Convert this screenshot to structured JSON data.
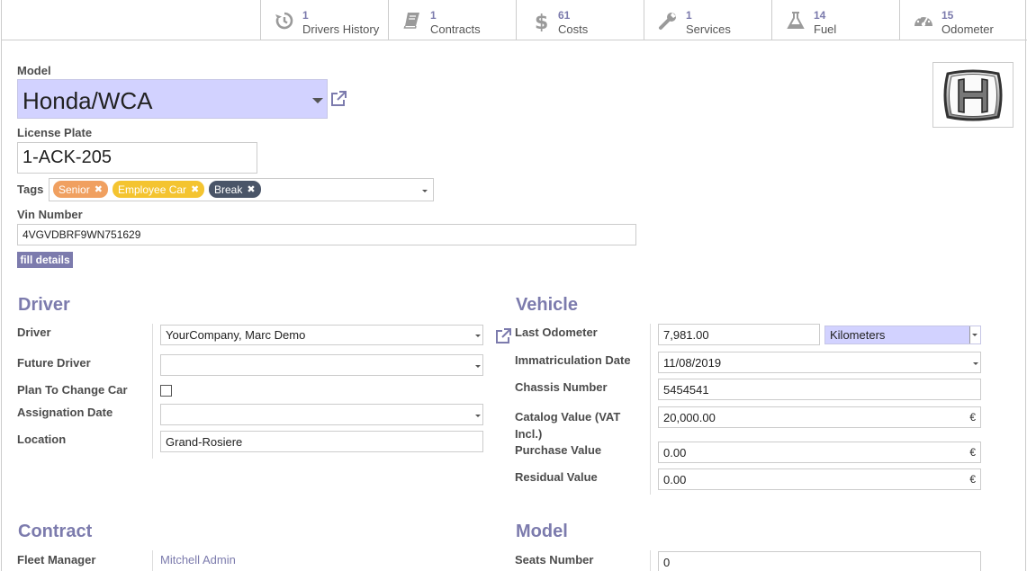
{
  "smart_buttons": [
    {
      "value": "1",
      "label": "Drivers History",
      "icon": "history-icon"
    },
    {
      "value": "1",
      "label": "Contracts",
      "icon": "book-icon"
    },
    {
      "value": "61",
      "label": "Costs",
      "icon": "dollar-icon"
    },
    {
      "value": "1",
      "label": "Services",
      "icon": "wrench-icon"
    },
    {
      "value": "14",
      "label": "Fuel",
      "icon": "flask-icon"
    },
    {
      "value": "15",
      "label": "Odometer",
      "icon": "tachometer-icon"
    }
  ],
  "header": {
    "model_label": "Model",
    "model_value": "Honda/WCA",
    "plate_label": "License Plate",
    "plate_value": "1-ACK-205",
    "tags_label": "Tags",
    "tags": [
      {
        "name": "Senior",
        "color": "#f0a060"
      },
      {
        "name": "Employee Car",
        "color": "#f4c430"
      },
      {
        "name": "Break",
        "color": "#4a5568"
      }
    ],
    "vin_label": "Vin Number",
    "vin_value": "4VGVDBRF9WN751629",
    "fill_details": "fill details"
  },
  "driver_section": {
    "title": "Driver",
    "driver_label": "Driver",
    "driver_value": "YourCompany, Marc Demo",
    "future_driver_label": "Future Driver",
    "future_driver_value": "",
    "plan_change_label": "Plan To Change Car",
    "plan_change_checked": false,
    "assignation_label": "Assignation Date",
    "assignation_value": "",
    "location_label": "Location",
    "location_value": "Grand-Rosiere"
  },
  "vehicle_section": {
    "title": "Vehicle",
    "odometer_label": "Last Odometer",
    "odometer_value": "7,981.00",
    "odometer_unit": "Kilometers",
    "immat_label": "Immatriculation Date",
    "immat_value": "11/08/2019",
    "chassis_label": "Chassis Number",
    "chassis_value": "5454541",
    "catalog_label_1": "Catalog Value (VAT",
    "catalog_label_2": "Incl.)",
    "catalog_value": "20,000.00",
    "purchase_label": "Purchase Value",
    "purchase_value": "0.00",
    "residual_label": "Residual Value",
    "residual_value": "0.00",
    "currency": "€"
  },
  "contract_section": {
    "title": "Contract",
    "fleet_manager_label": "Fleet Manager",
    "fleet_manager_value": "Mitchell Admin"
  },
  "model_section": {
    "title": "Model",
    "seats_label": "Seats Number",
    "seats_value": "0"
  },
  "colors": {
    "accent": "#7c7bad",
    "required_bg": "#d2d2ff"
  }
}
